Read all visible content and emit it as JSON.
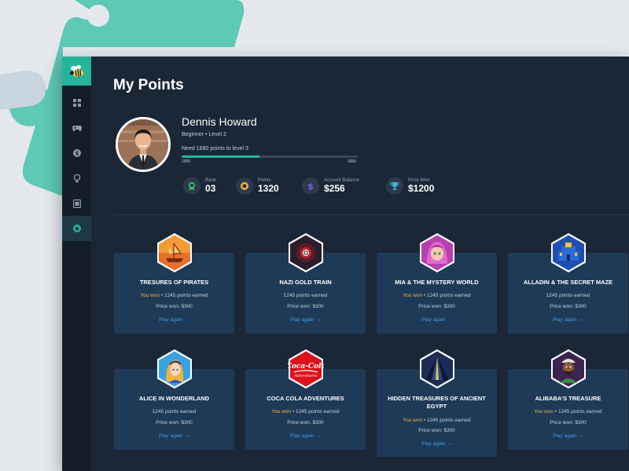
{
  "page": {
    "title": "My Points"
  },
  "sidebar": {
    "items": [
      {
        "name": "dashboard-icon"
      },
      {
        "name": "gamepad-icon"
      },
      {
        "name": "dollar-icon"
      },
      {
        "name": "lightbulb-icon"
      },
      {
        "name": "gift-box-icon"
      },
      {
        "name": "points-star-icon",
        "active": true
      }
    ]
  },
  "profile": {
    "name": "Dennis Howard",
    "level": "Beginner • Level 2",
    "progress_label": "Need 1680 points to level 3",
    "progress_min": "1000",
    "progress_max": "3000",
    "progress_fraction": 0.44
  },
  "stats": [
    {
      "label": "Rank",
      "value": "03",
      "icon": "rank-medal-icon",
      "color": "#3dbb63"
    },
    {
      "label": "Points",
      "value": "1320",
      "icon": "coin-icon",
      "color": "#f3b33d"
    },
    {
      "label": "Account Balance",
      "value": "$256",
      "icon": "dollar-icon",
      "color": "#7a5ce5"
    },
    {
      "label": "Prize Won",
      "value": "$1200",
      "icon": "trophy-icon",
      "color": "#3bb7d3"
    }
  ],
  "cards": [
    {
      "title": "TRESURES OF PIRATES",
      "won": "You won",
      "points": "• 1245 points earned",
      "price": "Price won: $300",
      "link": "Play again  →"
    },
    {
      "title": "NAZI GOLD TRAIN",
      "won": "",
      "points": "1245 points earned",
      "price": "Price won: $300",
      "link": "Play again  →"
    },
    {
      "title": "MIA & THE MYSTERY WORLD",
      "won": "You won",
      "points": "• 1245 points earned",
      "price": "Price won: $300",
      "link": "Play again  →"
    },
    {
      "title": "ALLADIN & THE SECRET MAZE",
      "won": "",
      "points": "1245 points earned",
      "price": "Price won: $300",
      "link": "Play again  →"
    },
    {
      "title": "ALICE IN WONDERLAND",
      "won": "",
      "points": "1245 points earned",
      "price": "Price won: $300",
      "link": "Play again  →"
    },
    {
      "title": "COCA COLA ADVENTURES",
      "won": "You won",
      "points": "• 1245 points earned",
      "price": "Price won: $300",
      "link": "Play again  →"
    },
    {
      "title": "HIDDEN TREASURES OF ANCIENT EGYPT",
      "won": "You won",
      "points": "• 1245 points earned",
      "price": "Price won: $300",
      "link": "Play again  →"
    },
    {
      "title": "ALIBABA'S TREASURE",
      "won": "You won",
      "points": "• 1245 points earned",
      "price": "Price won: $300",
      "link": "Play again  →"
    }
  ]
}
